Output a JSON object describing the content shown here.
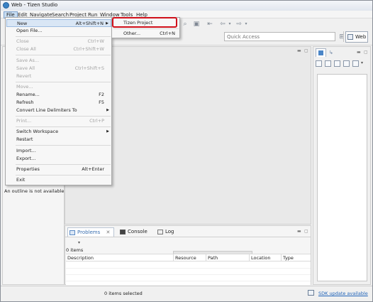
{
  "window": {
    "title": "Web - Tizen Studio"
  },
  "menubar": [
    "File",
    "Edit",
    "Navigate",
    "Search",
    "Project",
    "Run",
    "Window",
    "Tools",
    "Help"
  ],
  "toolbar": {
    "quick_access_placeholder": "Quick Access",
    "perspective_label": "Web"
  },
  "file_menu": {
    "new": {
      "label": "New",
      "accel": "Alt+Shift+N"
    },
    "open_file": {
      "label": "Open File..."
    },
    "close": {
      "label": "Close",
      "accel": "Ctrl+W"
    },
    "close_all": {
      "label": "Close All",
      "accel": "Ctrl+Shift+W"
    },
    "save_as": {
      "label": "Save As..."
    },
    "save_all": {
      "label": "Save All",
      "accel": "Ctrl+Shift+S"
    },
    "revert": {
      "label": "Revert"
    },
    "move": {
      "label": "Move..."
    },
    "rename": {
      "label": "Rename...",
      "accel": "F2"
    },
    "refresh": {
      "label": "Refresh",
      "accel": "F5"
    },
    "convert": {
      "label": "Convert Line Delimiters To"
    },
    "print": {
      "label": "Print...",
      "accel": "Ctrl+P"
    },
    "switch_workspace": {
      "label": "Switch Workspace"
    },
    "restart": {
      "label": "Restart"
    },
    "import": {
      "label": "Import..."
    },
    "export": {
      "label": "Export..."
    },
    "properties": {
      "label": "Properties",
      "accel": "Alt+Enter"
    },
    "exit": {
      "label": "Exit"
    }
  },
  "new_submenu": {
    "tizen_project": {
      "label": "Tizen Project"
    },
    "other": {
      "label": "Other...",
      "accel": "Ctrl+N"
    }
  },
  "outline": {
    "message": "An outline is not available."
  },
  "bottom_panel": {
    "tabs": [
      "Problems",
      "Console",
      "Log"
    ],
    "items_count": "0 items",
    "columns": [
      "Description",
      "Resource",
      "Path",
      "Location",
      "Type"
    ]
  },
  "statusbar": {
    "selection": "0 items selected",
    "sdk_update": "SDK update available"
  },
  "colors": {
    "highlight_outline": "#d0101a",
    "accent": "#4a85c7"
  }
}
